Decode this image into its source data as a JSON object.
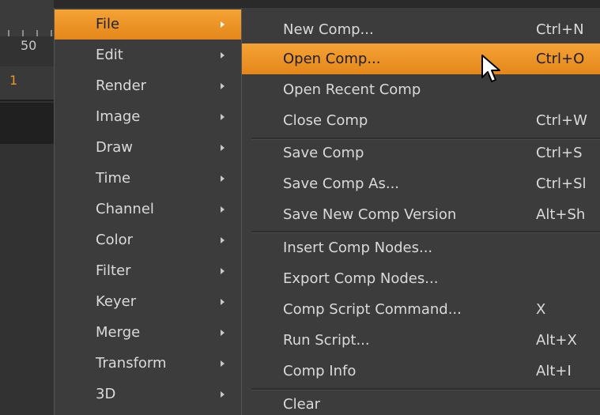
{
  "timeline": {
    "ruler_value": "50",
    "current_frame": "1"
  },
  "main_menu": {
    "items": [
      {
        "label": "File",
        "active": true
      },
      {
        "label": "Edit"
      },
      {
        "label": "Render"
      },
      {
        "label": "Image"
      },
      {
        "label": "Draw"
      },
      {
        "label": "Time"
      },
      {
        "label": "Channel"
      },
      {
        "label": "Color"
      },
      {
        "label": "Filter"
      },
      {
        "label": "Keyer"
      },
      {
        "label": "Merge"
      },
      {
        "label": "Transform"
      },
      {
        "label": "3D"
      }
    ]
  },
  "file_menu": {
    "items": [
      {
        "label": "New Comp...",
        "shortcut": "Ctrl+N"
      },
      {
        "label": "Open Comp...",
        "shortcut": "Ctrl+O",
        "active": true
      },
      {
        "label": "Open Recent Comp",
        "shortcut": ""
      },
      {
        "label": "Close Comp",
        "shortcut": "Ctrl+W"
      },
      {
        "label": "Save Comp",
        "shortcut": "Ctrl+S"
      },
      {
        "label": "Save Comp As...",
        "shortcut": "Ctrl+Sl"
      },
      {
        "label": "Save New Comp Version",
        "shortcut": "Alt+Sh"
      },
      {
        "label": "Insert Comp Nodes...",
        "shortcut": ""
      },
      {
        "label": "Export Comp Nodes...",
        "shortcut": ""
      },
      {
        "label": "Comp Script Command...",
        "shortcut": "X"
      },
      {
        "label": "Run Script...",
        "shortcut": "Alt+X"
      },
      {
        "label": "Comp Info",
        "shortcut": "Alt+I"
      },
      {
        "label": "Clear",
        "shortcut": ""
      }
    ]
  },
  "colors": {
    "highlight": "#f29a2e",
    "menu_bg": "#3c3c3c",
    "frame_accent": "#e8962a"
  },
  "icons": [
    "submenu-arrow-icon",
    "mouse-pointer-icon"
  ]
}
